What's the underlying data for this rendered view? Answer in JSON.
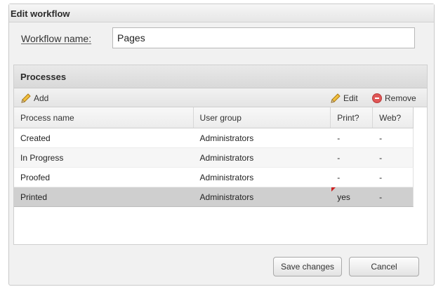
{
  "dialog": {
    "title": "Edit workflow",
    "name_label": "Workflow name:",
    "name_value": "Pages"
  },
  "processes": {
    "header": "Processes",
    "toolbar": {
      "add_label": "Add",
      "add_icon": "pencil-icon",
      "edit_label": "Edit",
      "edit_icon": "pencil-icon",
      "remove_label": "Remove",
      "remove_icon": "remove-icon"
    },
    "columns": [
      "Process name",
      "User group",
      "Print?",
      "Web?"
    ],
    "rows": [
      {
        "name": "Created",
        "group": "Administrators",
        "print": "-",
        "web": "-"
      },
      {
        "name": "In Progress",
        "group": "Administrators",
        "print": "-",
        "web": "-"
      },
      {
        "name": "Proofed",
        "group": "Administrators",
        "print": "-",
        "web": "-"
      },
      {
        "name": "Printed",
        "group": "Administrators",
        "print": "yes",
        "web": "-",
        "selected": true
      }
    ]
  },
  "buttons": {
    "save": "Save changes",
    "cancel": "Cancel"
  },
  "colors": {
    "selected_row": "#cfcfcf",
    "remove_icon": "#e05757",
    "dirty_marker": "#cc2020",
    "pencil": "#e8b03a"
  }
}
